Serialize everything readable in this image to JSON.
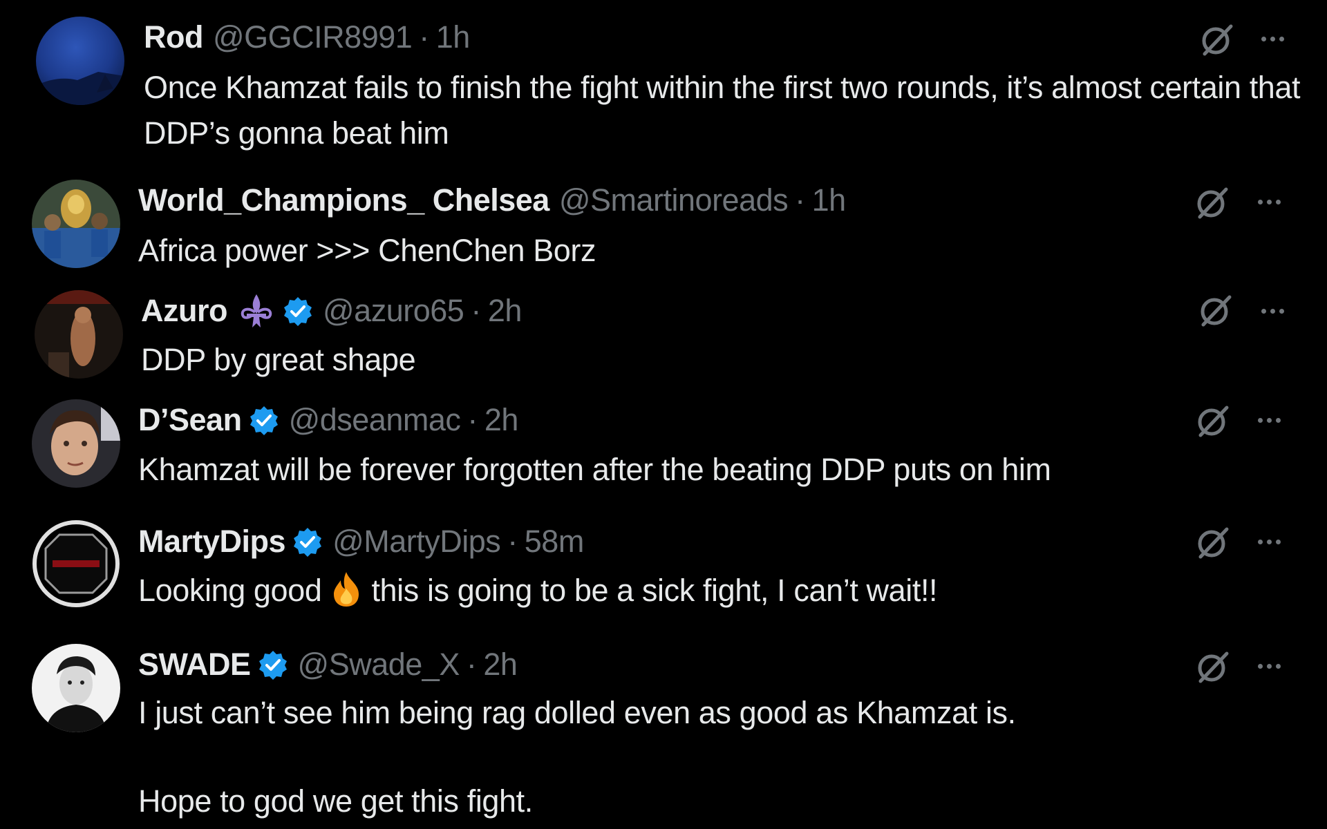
{
  "replies": [
    {
      "display_name": "Rod",
      "handle": "@GGCIR8991",
      "separator": "·",
      "time": "1h",
      "verified": false,
      "text": "Once Khamzat fails to finish the fight within the first two rounds, it’s almost certain that DDP’s gonna beat him",
      "avatar": "blue-night-sky-avatar"
    },
    {
      "display_name": "World_Champions_ Chelsea",
      "handle": "@Smartinoreads",
      "separator": "·",
      "time": "1h",
      "verified": false,
      "text": "Africa power >>> ChenChen Borz",
      "avatar": "trophy-celebration-avatar"
    },
    {
      "display_name": "Azuro",
      "handle": "@azuro65",
      "separator": "·",
      "time": "2h",
      "verified": true,
      "emoji_badge": "fleur-de-lis-icon",
      "text": "DDP by great shape",
      "avatar": "fighter-avatar"
    },
    {
      "display_name": "D’Sean",
      "handle": "@dseanmac",
      "separator": "·",
      "time": "2h",
      "verified": true,
      "text": "Khamzat will be forever forgotten after the beating DDP puts on him",
      "avatar": "portrait-avatar"
    },
    {
      "display_name": "MartyDips",
      "handle": "@MartyDips",
      "separator": "·",
      "time": "58m",
      "verified": true,
      "text_before": "Looking good",
      "inline_emoji": "fire-emoji",
      "text_after": "this is going to be a sick fight, I can’t wait!!",
      "avatar": "octagon-logo-avatar"
    },
    {
      "display_name": "SWADE",
      "handle": "@Swade_X",
      "separator": "·",
      "time": "2h",
      "verified": true,
      "text": "I just can’t see him being rag dolled even as good as Khamzat is.\n\nHope to god we get this fight.",
      "avatar": "bw-portrait-avatar"
    }
  ],
  "colors": {
    "background": "#000000",
    "primary_text": "#e7e9ea",
    "secondary_text": "#71767b",
    "verified_blue": "#1d9bf0"
  }
}
